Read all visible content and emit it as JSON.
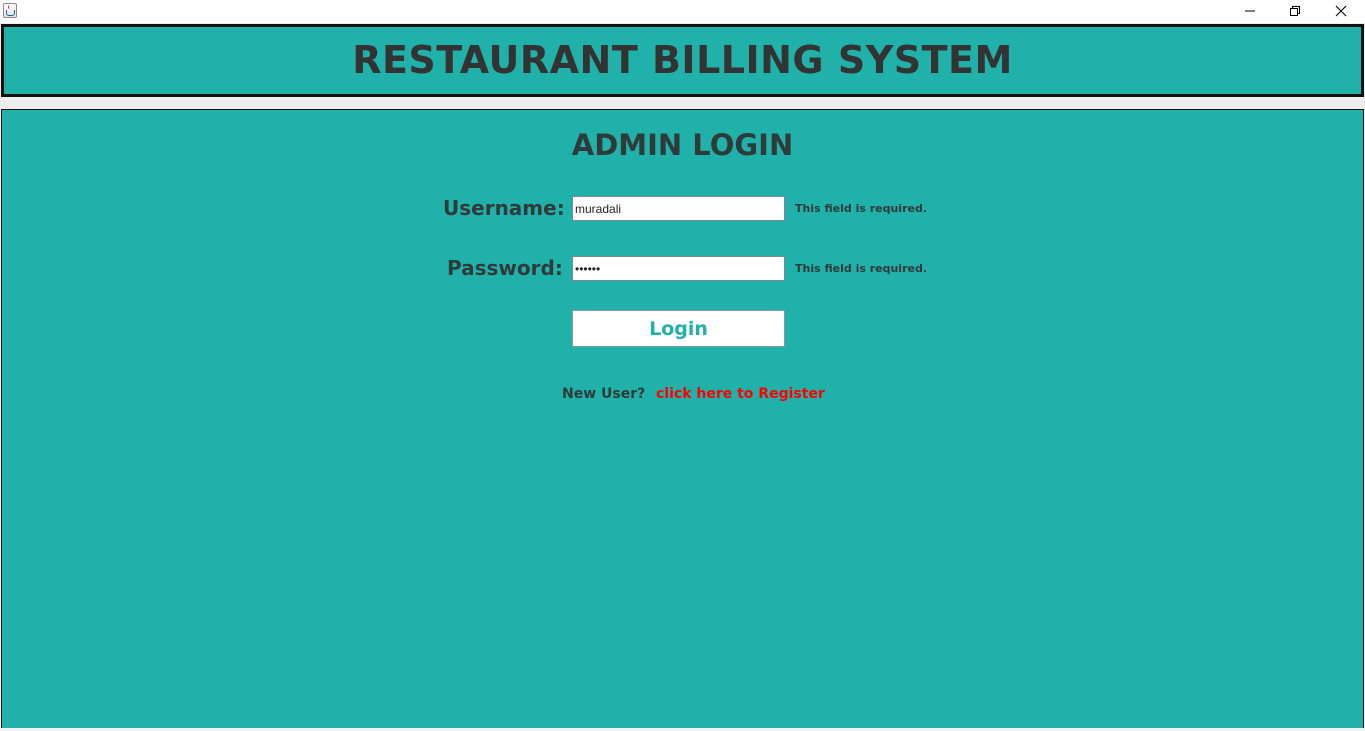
{
  "window": {
    "icon": "java-cup-icon",
    "controls": {
      "minimize_icon": "minimize-icon",
      "restore_icon": "restore-icon",
      "close_icon": "close-icon"
    }
  },
  "header": {
    "title": "RESTAURANT BILLING SYSTEM"
  },
  "login": {
    "title": "ADMIN LOGIN",
    "username_label": "Username:",
    "username_value": "muradali",
    "username_note": "This field is required.",
    "password_label": "Password:",
    "password_value": "••••••",
    "password_note": "This field is required.",
    "login_button": "Login",
    "new_user_label": "New User?",
    "register_link": "click here to Register"
  },
  "colors": {
    "panel_bg": "#20b2aa",
    "text_dark": "#2f3b3b",
    "link": "#ff0000",
    "button_text": "#20b2aa"
  }
}
